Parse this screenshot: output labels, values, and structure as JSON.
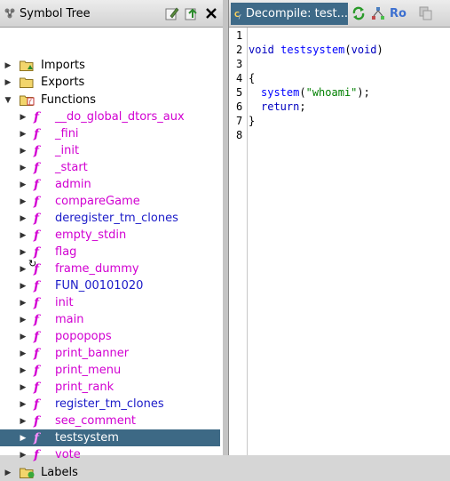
{
  "symbol_tree": {
    "title": "Symbol Tree",
    "nodes": {
      "imports": "Imports",
      "exports": "Exports",
      "functions": "Functions",
      "labels": "Labels"
    },
    "functions": [
      {
        "name": "__do_global_dtors_aux",
        "color": "#d100d1"
      },
      {
        "name": "_fini",
        "color": "#d100d1"
      },
      {
        "name": "_init",
        "color": "#d100d1"
      },
      {
        "name": "_start",
        "color": "#d100d1"
      },
      {
        "name": "admin",
        "color": "#d100d1"
      },
      {
        "name": "compareGame",
        "color": "#d100d1"
      },
      {
        "name": "deregister_tm_clones",
        "color": "#1a1ac8"
      },
      {
        "name": "empty_stdin",
        "color": "#d100d1"
      },
      {
        "name": "flag",
        "color": "#d100d1"
      },
      {
        "name": "frame_dummy",
        "color": "#d100d1"
      },
      {
        "name": "FUN_00101020",
        "color": "#1a1ac8"
      },
      {
        "name": "init",
        "color": "#d100d1"
      },
      {
        "name": "main",
        "color": "#d100d1"
      },
      {
        "name": "popopops",
        "color": "#d100d1"
      },
      {
        "name": "print_banner",
        "color": "#d100d1"
      },
      {
        "name": "print_menu",
        "color": "#d100d1"
      },
      {
        "name": "print_rank",
        "color": "#d100d1"
      },
      {
        "name": "register_tm_clones",
        "color": "#1a1ac8"
      },
      {
        "name": "see_comment",
        "color": "#d100d1"
      },
      {
        "name": "testsystem",
        "color": "#ffffff",
        "selected": true
      },
      {
        "name": "vote",
        "color": "#d100d1"
      }
    ]
  },
  "decompiler": {
    "tab_title": "Decompile: test...",
    "ro_label": "Ro",
    "line_numbers": [
      "1",
      "2",
      "3",
      "4",
      "5",
      "6",
      "7",
      "8"
    ],
    "lines": {
      "l2_type": "void",
      "l2_name": "testsystem",
      "l2_open": "(",
      "l2_param": "void",
      "l2_close": ")",
      "l4": "{",
      "l5_call": "system",
      "l5_open": "(",
      "l5_str": "\"whoami\"",
      "l5_end": ");",
      "l6_kw": "return",
      "l6_end": ";",
      "l7": "}"
    }
  },
  "colors": {
    "selection": "#3d6985",
    "tab_active": "#3e6a88",
    "function_default": "#d100d1",
    "function_thunk": "#1a1ac8",
    "keyword": "#0000c0",
    "string": "#008000"
  }
}
